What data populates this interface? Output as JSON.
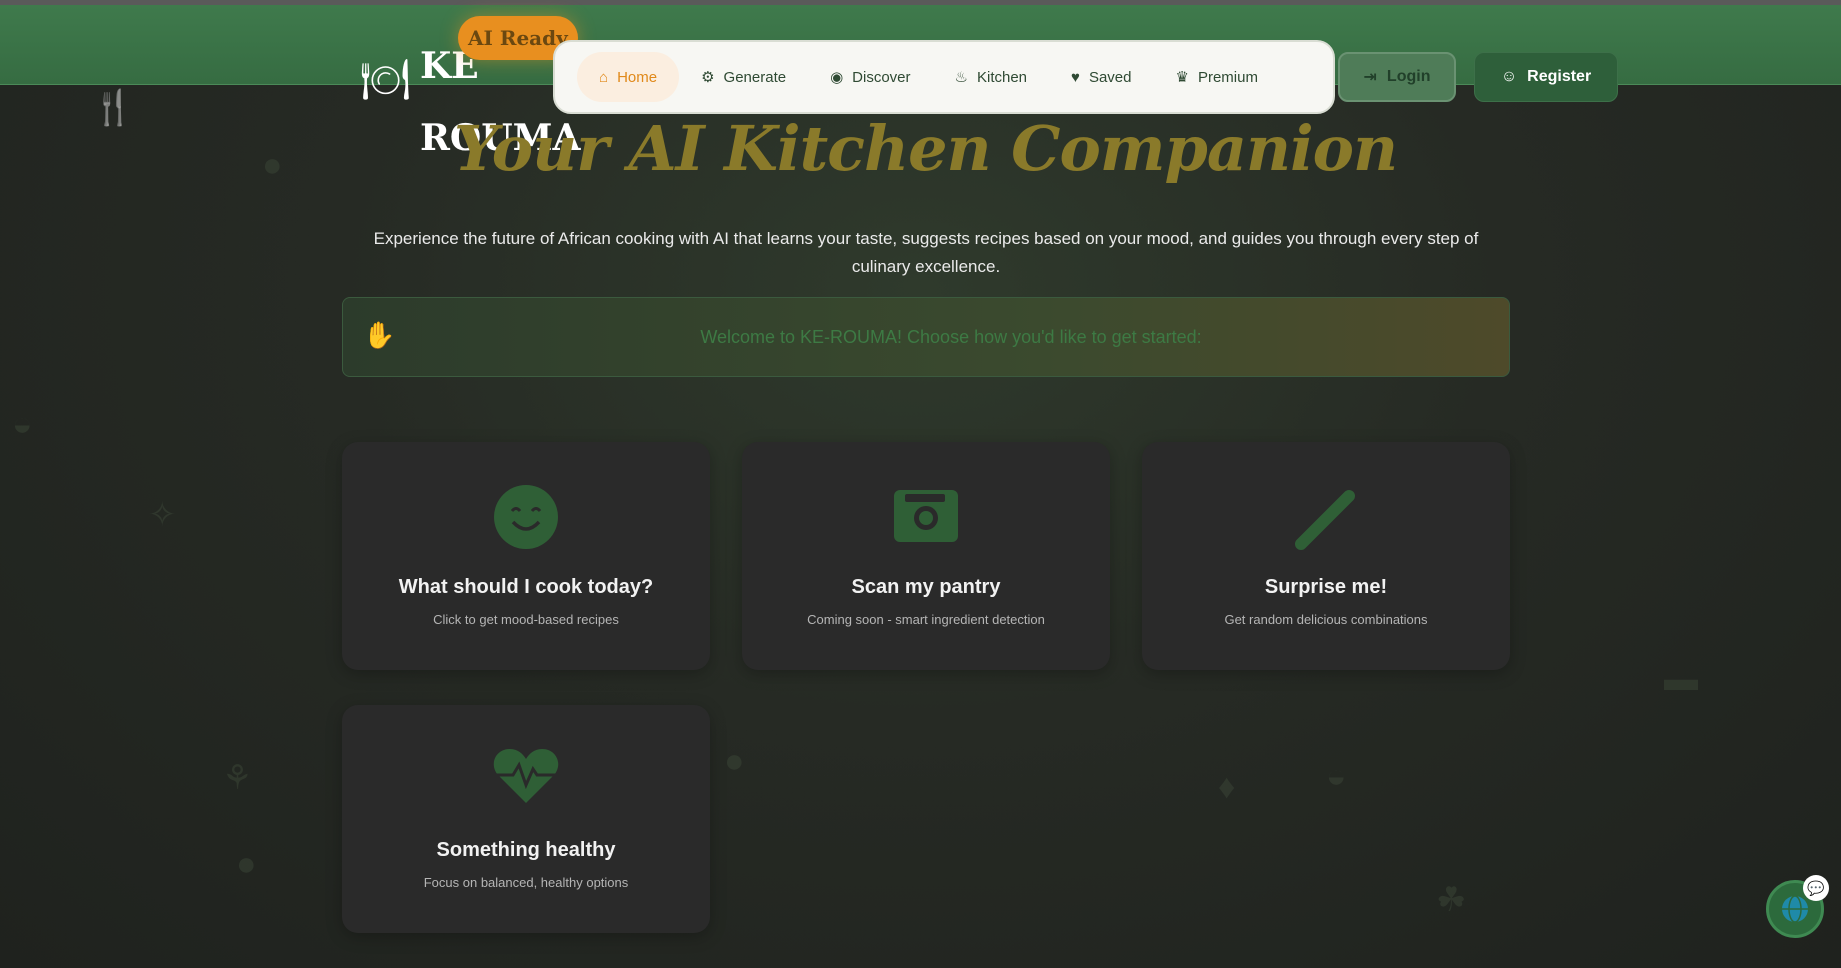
{
  "brand": {
    "name": "KE ROUMA",
    "badge": "AI Ready"
  },
  "nav": {
    "items": [
      {
        "label": "Home",
        "icon": "home-icon",
        "active": true
      },
      {
        "label": "Generate",
        "icon": "robot-icon",
        "active": false
      },
      {
        "label": "Discover",
        "icon": "compass-icon",
        "active": false
      },
      {
        "label": "Kitchen",
        "icon": "flame-icon",
        "active": false
      },
      {
        "label": "Saved",
        "icon": "heart-icon",
        "active": false
      },
      {
        "label": "Premium",
        "icon": "crown-icon",
        "active": false
      }
    ]
  },
  "auth": {
    "login_label": "Login",
    "register_label": "Register"
  },
  "hero": {
    "title": "Your AI Kitchen Companion",
    "subtitle": "Experience the future of African cooking with AI that learns your taste, suggests recipes based on your mood, and guides you through every step of culinary excellence."
  },
  "welcome": {
    "message": "Welcome to KE-ROUMA! Choose how you'd like to get started:"
  },
  "cards": [
    {
      "title": "What should I cook today?",
      "desc": "Click to get mood-based recipes",
      "icon": "smile-icon"
    },
    {
      "title": "Scan my pantry",
      "desc": "Coming soon - smart ingredient detection",
      "icon": "camera-icon"
    },
    {
      "title": "Surprise me!",
      "desc": "Get random delicious combinations",
      "icon": "wand-icon"
    },
    {
      "title": "Something healthy",
      "desc": "Focus on balanced, healthy options",
      "icon": "heartbeat-icon"
    }
  ],
  "colors": {
    "header": "#3f7a4c",
    "accent": "#e88f1f",
    "card_icon": "#2f5f36",
    "title_gold": "#8a7a2a"
  }
}
